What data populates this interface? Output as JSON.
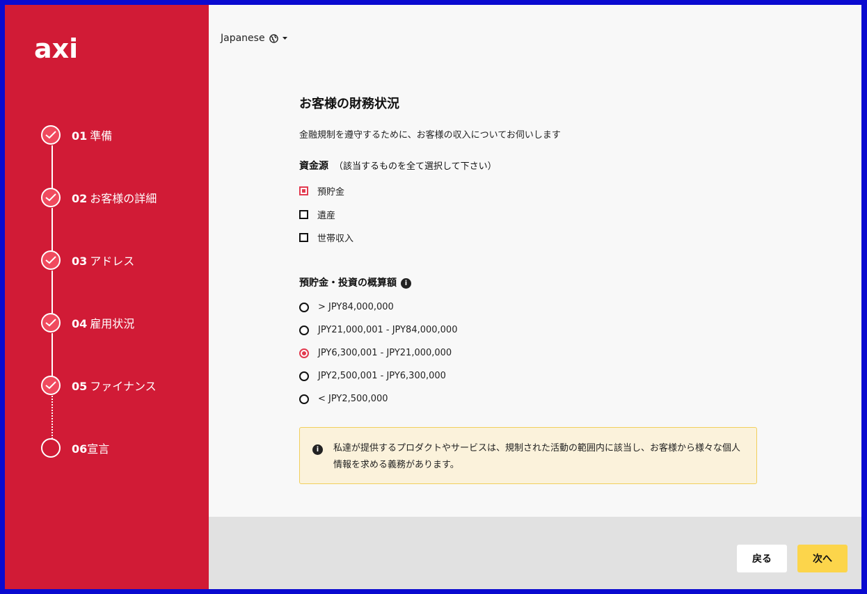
{
  "brand": {
    "logo_text": "axi"
  },
  "steps": [
    {
      "num": "01",
      "label": "準備",
      "done": true
    },
    {
      "num": "02",
      "label": "お客様の詳細",
      "done": true
    },
    {
      "num": "03",
      "label": "アドレス",
      "done": true
    },
    {
      "num": "04",
      "label": "雇用状況",
      "done": true
    },
    {
      "num": "05",
      "label": "ファイナンス",
      "done": true
    },
    {
      "num": "06",
      "label": "宣言",
      "done": false
    }
  ],
  "language": {
    "label": "Japanese"
  },
  "page": {
    "title": "お客様の財務状況",
    "subtitle": "金融規制を遵守するために、お客様の収入についてお伺いします"
  },
  "funds_source": {
    "label": "資金源",
    "note": "（該当するものを全て選択して下さい）",
    "options": [
      {
        "label": "預貯金",
        "checked": true
      },
      {
        "label": "遺産",
        "checked": false
      },
      {
        "label": "世帯収入",
        "checked": false
      }
    ]
  },
  "savings": {
    "label": "預貯金・投資の概算額",
    "info_glyph": "i",
    "options": [
      {
        "label": "> JPY84,000,000",
        "selected": false
      },
      {
        "label": "JPY21,000,001 - JPY84,000,000",
        "selected": false
      },
      {
        "label": "JPY6,300,001 - JPY21,000,000",
        "selected": true
      },
      {
        "label": "JPY2,500,001 - JPY6,300,000",
        "selected": false
      },
      {
        "label": "< JPY2,500,000",
        "selected": false
      }
    ]
  },
  "notice": {
    "icon": "i",
    "text": "私達が提供するプロダクトやサービスは、規制された活動の範囲内に該当し、お客様から様々な個人情報を求める義務があります。"
  },
  "footer": {
    "back_label": "戻る",
    "next_label": "次へ"
  },
  "colors": {
    "sidebar": "#d11b36",
    "accent": "#e23a4f",
    "next_button": "#fcd54b",
    "notice_bg": "#fbf2db",
    "frame": "#0a0ad0"
  }
}
